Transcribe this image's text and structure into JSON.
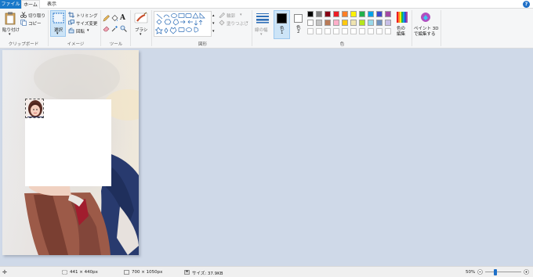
{
  "tabs": {
    "file": "ファイル",
    "home": "ホーム",
    "view": "表示"
  },
  "clipboard": {
    "paste": "貼り付け",
    "cut": "切り取り",
    "copy": "コピー",
    "group": "クリップボード"
  },
  "image": {
    "select": "選択",
    "crop": "トリミング",
    "resize": "サイズ変更",
    "rotate": "回転",
    "group": "イメージ"
  },
  "tools": {
    "group": "ツール"
  },
  "brushes": {
    "label": "ブラシ"
  },
  "shapes": {
    "outline": "輪郭",
    "fill": "塗りつぶし",
    "group": "図形"
  },
  "size": {
    "label": "線の幅"
  },
  "colors": {
    "color1": "色\n1",
    "color1_top": "色",
    "color1_bottom": "1",
    "color2_top": "色",
    "color2_bottom": "2",
    "edit_top": "色の",
    "edit_bottom": "編集",
    "group": "色",
    "palette_row1": [
      "#000000",
      "#7f7f7f",
      "#880015",
      "#ed1c24",
      "#ff7f27",
      "#fff200",
      "#22b14c",
      "#00a2e8",
      "#3f48cc",
      "#a349a4"
    ],
    "palette_row2": [
      "#ffffff",
      "#c3c3c3",
      "#b97a57",
      "#ffaec9",
      "#ffc90e",
      "#efe4b0",
      "#b5e61d",
      "#99d9ea",
      "#7092be",
      "#c8bfe7"
    ],
    "color1_value": "#000000",
    "color2_value": "#ffffff"
  },
  "paint3d": {
    "top": "ペイント 3D",
    "bottom": "で編集する"
  },
  "status": {
    "selection_size": "441 × 440px",
    "image_size": "700 × 1050px",
    "file_size": "サイズ: 37.9KB",
    "zoom": "50%"
  }
}
